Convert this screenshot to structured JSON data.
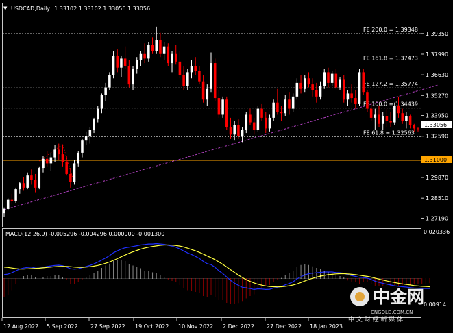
{
  "header": {
    "symbol": "USDCAD,Daily",
    "ohlc": "1.33102 1.33102 1.33056 1.33056",
    "menu_icon": "triangle-down-icon"
  },
  "macd_header": "MACD(12,26,9) -0.005296 -0.004296 0.000000 -0.001300",
  "colors": {
    "background": "#000000",
    "bull": "#ffffff",
    "bear": "#ff0000",
    "grid": "#c8c8c8",
    "support": "#ffa500",
    "trend": "#b040c0",
    "macd_line": "#2030ff",
    "signal_line": "#ffff40"
  },
  "watermark": {
    "brand": "中金网",
    "url": "CNGOLD.COM.CN",
    "tagline": "中 文 财 经 新 媒 体"
  },
  "chart_data": [
    {
      "type": "candlestick",
      "title": "USDCAD,Daily",
      "ylim": [
        1.2685,
        1.4065
      ],
      "y_ticks": [
        "1.39350",
        "1.37990",
        "1.36630",
        "1.35270",
        "1.33950",
        "1.32590",
        "1.29870",
        "1.28510",
        "1.27190"
      ],
      "x_ticks": [
        "12 Aug 2022",
        "5 Sep 2022",
        "27 Sep 2022",
        "19 Oct 2022",
        "10 Nov 2022",
        "2 Dec 2022",
        "27 Dec 2022",
        "18 Jan 2023"
      ],
      "current_price": "1.33056",
      "support_level": {
        "label": "1.31000",
        "value": 1.31
      },
      "fibonacci_levels": [
        {
          "label": "FE 200.0 = 1.39348",
          "value": 1.39348
        },
        {
          "label": "FE 161.8 = 1.37473",
          "value": 1.37473
        },
        {
          "label": "FE 127.2 = 1.35774",
          "value": 1.35774
        },
        {
          "label": "FE 100.0 = 1.34439",
          "value": 1.34439
        },
        {
          "label": "FE 61.8 = 1.32563",
          "value": 1.32563
        }
      ],
      "trendline": {
        "from": {
          "bar": 0,
          "value": 1.2775
        },
        "to": {
          "bar": 111,
          "value": 1.3595
        }
      },
      "dashed_lines": [
        {
          "from": {
            "bar": 9,
            "value": 1.3095
          },
          "to": {
            "bar": 15,
            "value": 1.3205
          }
        },
        {
          "from": {
            "bar": 15,
            "value": 1.3205
          },
          "to": {
            "bar": 18,
            "value": 1.2945
          }
        }
      ],
      "candles": [
        [
          1.2752,
          1.279,
          1.273,
          1.278
        ],
        [
          1.278,
          1.285,
          1.277,
          1.284
        ],
        [
          1.284,
          1.288,
          1.281,
          1.283
        ],
        [
          1.283,
          1.292,
          1.282,
          1.291
        ],
        [
          1.291,
          1.296,
          1.288,
          1.295
        ],
        [
          1.295,
          1.299,
          1.29,
          1.292
        ],
        [
          1.292,
          1.302,
          1.291,
          1.3
        ],
        [
          1.3,
          1.304,
          1.294,
          1.297
        ],
        [
          1.297,
          1.301,
          1.289,
          1.292
        ],
        [
          1.292,
          1.306,
          1.291,
          1.305
        ],
        [
          1.305,
          1.313,
          1.302,
          1.311
        ],
        [
          1.311,
          1.316,
          1.306,
          1.308
        ],
        [
          1.308,
          1.315,
          1.303,
          1.312
        ],
        [
          1.312,
          1.32,
          1.309,
          1.317
        ],
        [
          1.317,
          1.321,
          1.31,
          1.314
        ],
        [
          1.314,
          1.32,
          1.306,
          1.309
        ],
        [
          1.309,
          1.313,
          1.3,
          1.301
        ],
        [
          1.301,
          1.305,
          1.292,
          1.296
        ],
        [
          1.296,
          1.31,
          1.294,
          1.308
        ],
        [
          1.308,
          1.316,
          1.306,
          1.315
        ],
        [
          1.315,
          1.324,
          1.312,
          1.323
        ],
        [
          1.323,
          1.329,
          1.32,
          1.326
        ],
        [
          1.326,
          1.332,
          1.321,
          1.33
        ],
        [
          1.33,
          1.338,
          1.328,
          1.337
        ],
        [
          1.337,
          1.346,
          1.335,
          1.344
        ],
        [
          1.344,
          1.354,
          1.341,
          1.353
        ],
        [
          1.353,
          1.361,
          1.349,
          1.358
        ],
        [
          1.358,
          1.368,
          1.356,
          1.366
        ],
        [
          1.366,
          1.382,
          1.364,
          1.379
        ],
        [
          1.379,
          1.383,
          1.368,
          1.371
        ],
        [
          1.371,
          1.379,
          1.365,
          1.377
        ],
        [
          1.377,
          1.385,
          1.37,
          1.372
        ],
        [
          1.372,
          1.376,
          1.358,
          1.36
        ],
        [
          1.36,
          1.372,
          1.356,
          1.37
        ],
        [
          1.37,
          1.378,
          1.367,
          1.376
        ],
        [
          1.376,
          1.382,
          1.372,
          1.38
        ],
        [
          1.38,
          1.387,
          1.374,
          1.377
        ],
        [
          1.377,
          1.388,
          1.375,
          1.386
        ],
        [
          1.386,
          1.391,
          1.38,
          1.382
        ],
        [
          1.382,
          1.398,
          1.38,
          1.389
        ],
        [
          1.389,
          1.394,
          1.378,
          1.38
        ],
        [
          1.38,
          1.388,
          1.376,
          1.385
        ],
        [
          1.385,
          1.387,
          1.372,
          1.374
        ],
        [
          1.374,
          1.382,
          1.368,
          1.38
        ],
        [
          1.38,
          1.386,
          1.373,
          1.375
        ],
        [
          1.375,
          1.382,
          1.364,
          1.366
        ],
        [
          1.366,
          1.372,
          1.356,
          1.359
        ],
        [
          1.359,
          1.37,
          1.356,
          1.368
        ],
        [
          1.368,
          1.376,
          1.364,
          1.372
        ],
        [
          1.372,
          1.378,
          1.366,
          1.369
        ],
        [
          1.369,
          1.372,
          1.36,
          1.362
        ],
        [
          1.362,
          1.366,
          1.348,
          1.35
        ],
        [
          1.35,
          1.36,
          1.346,
          1.357
        ],
        [
          1.357,
          1.381,
          1.355,
          1.374
        ],
        [
          1.374,
          1.377,
          1.349,
          1.351
        ],
        [
          1.351,
          1.356,
          1.338,
          1.34
        ],
        [
          1.34,
          1.352,
          1.338,
          1.35
        ],
        [
          1.35,
          1.352,
          1.33,
          1.332
        ],
        [
          1.332,
          1.338,
          1.324,
          1.327
        ],
        [
          1.327,
          1.336,
          1.323,
          1.333
        ],
        [
          1.333,
          1.337,
          1.324,
          1.326
        ],
        [
          1.326,
          1.332,
          1.322,
          1.33
        ],
        [
          1.33,
          1.342,
          1.328,
          1.34
        ],
        [
          1.34,
          1.344,
          1.333,
          1.335
        ],
        [
          1.335,
          1.338,
          1.327,
          1.33
        ],
        [
          1.33,
          1.346,
          1.329,
          1.344
        ],
        [
          1.344,
          1.347,
          1.336,
          1.338
        ],
        [
          1.338,
          1.342,
          1.328,
          1.331
        ],
        [
          1.331,
          1.34,
          1.329,
          1.338
        ],
        [
          1.338,
          1.35,
          1.336,
          1.348
        ],
        [
          1.348,
          1.357,
          1.34,
          1.342
        ],
        [
          1.342,
          1.346,
          1.336,
          1.341
        ],
        [
          1.341,
          1.353,
          1.339,
          1.35
        ],
        [
          1.35,
          1.355,
          1.34,
          1.344
        ],
        [
          1.344,
          1.354,
          1.342,
          1.352
        ],
        [
          1.352,
          1.364,
          1.35,
          1.361
        ],
        [
          1.361,
          1.366,
          1.354,
          1.357
        ],
        [
          1.357,
          1.366,
          1.355,
          1.364
        ],
        [
          1.364,
          1.368,
          1.358,
          1.36
        ],
        [
          1.36,
          1.364,
          1.352,
          1.356
        ],
        [
          1.356,
          1.361,
          1.348,
          1.352
        ],
        [
          1.352,
          1.362,
          1.35,
          1.359
        ],
        [
          1.359,
          1.37,
          1.357,
          1.368
        ],
        [
          1.368,
          1.371,
          1.358,
          1.361
        ],
        [
          1.361,
          1.369,
          1.359,
          1.367
        ],
        [
          1.367,
          1.37,
          1.357,
          1.358
        ],
        [
          1.358,
          1.365,
          1.356,
          1.363
        ],
        [
          1.363,
          1.366,
          1.348,
          1.35
        ],
        [
          1.35,
          1.356,
          1.346,
          1.354
        ],
        [
          1.354,
          1.36,
          1.348,
          1.351
        ],
        [
          1.351,
          1.356,
          1.344,
          1.347
        ],
        [
          1.347,
          1.37,
          1.346,
          1.368
        ],
        [
          1.368,
          1.37,
          1.353,
          1.355
        ],
        [
          1.355,
          1.356,
          1.342,
          1.344
        ],
        [
          1.344,
          1.348,
          1.336,
          1.338
        ],
        [
          1.338,
          1.344,
          1.33,
          1.34
        ],
        [
          1.34,
          1.346,
          1.332,
          1.334
        ],
        [
          1.334,
          1.342,
          1.33,
          1.339
        ],
        [
          1.339,
          1.344,
          1.332,
          1.336
        ],
        [
          1.336,
          1.342,
          1.332,
          1.335
        ],
        [
          1.335,
          1.348,
          1.333,
          1.346
        ],
        [
          1.346,
          1.352,
          1.338,
          1.341
        ],
        [
          1.341,
          1.344,
          1.334,
          1.336
        ],
        [
          1.336,
          1.342,
          1.331,
          1.339
        ],
        [
          1.339,
          1.34,
          1.331,
          1.333
        ],
        [
          1.333,
          1.334,
          1.329,
          1.331
        ],
        [
          1.331,
          1.332,
          1.329,
          1.3306
        ]
      ]
    },
    {
      "type": "bar",
      "title": "MACD(12,26,9)",
      "ylim": [
        -0.0185,
        0.021
      ],
      "y_ticks": [
        "0.020336",
        "0.00914"
      ],
      "series": [
        {
          "name": "MACD(12,26,9)",
          "values": [
            0.002,
            0.0023,
            0.003,
            0.004,
            0.005,
            0.0055,
            0.0058,
            0.006,
            0.0055,
            0.0054,
            0.0058,
            0.0063,
            0.0066,
            0.0069,
            0.007,
            0.0067,
            0.006,
            0.0051,
            0.0049,
            0.0051,
            0.0057,
            0.0063,
            0.0069,
            0.0077,
            0.0086,
            0.0097,
            0.0108,
            0.012,
            0.0135,
            0.0145,
            0.0154,
            0.0161,
            0.0164,
            0.0168,
            0.0172,
            0.0176,
            0.0178,
            0.0181,
            0.0181,
            0.0183,
            0.0181,
            0.0179,
            0.0174,
            0.017,
            0.0164,
            0.0155,
            0.0144,
            0.0134,
            0.0126,
            0.0116,
            0.0105,
            0.009,
            0.0078,
            0.0073,
            0.0059,
            0.004,
            0.0026,
            0.0008,
            -0.001,
            -0.0024,
            -0.0036,
            -0.0046,
            -0.0049,
            -0.0053,
            -0.0057,
            -0.0054,
            -0.0055,
            -0.0057,
            -0.0056,
            -0.005,
            -0.0046,
            -0.0042,
            -0.0033,
            -0.0026,
            -0.0017,
            -0.0002,
            0.0009,
            0.0019,
            0.0025,
            0.0028,
            0.003,
            0.0032,
            0.0034,
            0.0034,
            0.0034,
            0.0031,
            0.003,
            0.0028,
            0.002,
            0.0015,
            0.0011,
            0.0006,
            0.0005,
            0.0002,
            -0.0005,
            -0.0014,
            -0.002,
            -0.0025,
            -0.003,
            -0.0034,
            -0.0038,
            -0.0041,
            -0.0043,
            -0.0045,
            -0.0048,
            -0.005,
            -0.0051,
            -0.0052,
            -0.0053,
            -0.0053
          ]
        },
        {
          "name": "Signal",
          "values": [
            0.006,
            0.0058,
            0.0055,
            0.0052,
            0.005,
            0.005,
            0.0051,
            0.0052,
            0.0053,
            0.0054,
            0.0056,
            0.0058,
            0.006,
            0.0062,
            0.0063,
            0.0064,
            0.0063,
            0.0062,
            0.006,
            0.0059,
            0.0059,
            0.006,
            0.0062,
            0.0065,
            0.0069,
            0.0074,
            0.008,
            0.0087,
            0.0095,
            0.0104,
            0.0114,
            0.0123,
            0.0132,
            0.014,
            0.0147,
            0.0154,
            0.016,
            0.0164,
            0.0168,
            0.0171,
            0.0174,
            0.0176,
            0.0176,
            0.0175,
            0.0173,
            0.017,
            0.0165,
            0.0159,
            0.0152,
            0.0145,
            0.0137,
            0.0128,
            0.0118,
            0.0109,
            0.0099,
            0.0087,
            0.0074,
            0.0061,
            0.0046,
            0.0032,
            0.0018,
            0.0005,
            -0.0006,
            -0.0015,
            -0.0023,
            -0.003,
            -0.0035,
            -0.0039,
            -0.0042,
            -0.0043,
            -0.0044,
            -0.0043,
            -0.0041,
            -0.0038,
            -0.0034,
            -0.0028,
            -0.0021,
            -0.0013,
            -0.0005,
            0.0001,
            0.0007,
            0.0012,
            0.0016,
            0.002,
            0.0022,
            0.0024,
            0.0025,
            0.0025,
            0.0024,
            0.0022,
            0.002,
            0.0017,
            0.0014,
            0.0011,
            0.0007,
            0.0002,
            -0.0003,
            -0.0008,
            -0.0013,
            -0.0017,
            -0.0021,
            -0.0025,
            -0.0028,
            -0.0031,
            -0.0034,
            -0.0037,
            -0.0039,
            -0.0041,
            -0.0042,
            -0.0043
          ]
        }
      ]
    }
  ]
}
